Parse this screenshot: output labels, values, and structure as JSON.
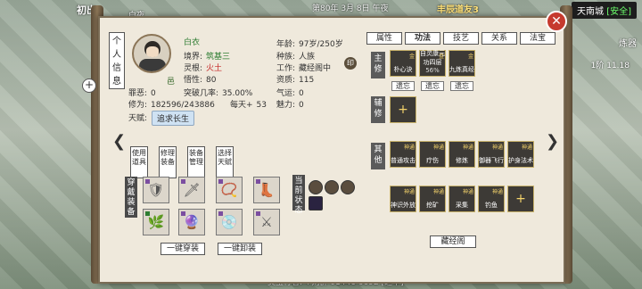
{
  "world": {
    "top_left_title": "初出",
    "time_of_day": "白夜",
    "top_center": "第80年 3月 8日 午夜",
    "top_event": "丰辰道友3",
    "city": "天南城",
    "city_status": "[安全]",
    "right_label1": "炼器",
    "right_label2": "1阶 11.18",
    "bottom_ticker": "灵宝行者: +刘群 01446 6692 [道本]",
    "bottom_count": "(1/10)"
  },
  "panel": {
    "vertical_title": "个人信息",
    "char_label_under_avatar": "邑",
    "name_label": "白衣",
    "tabs": [
      "属性",
      "功法",
      "技艺",
      "关系",
      "法宝"
    ],
    "active_tab": "功法",
    "info": {
      "realm_label": "境界:",
      "realm_value": "筑基三",
      "root_label": "灵根:",
      "root_value": "火土",
      "wisdom_label": "悟性:",
      "wisdom_value": "80",
      "sin_label": "罪恶:",
      "sin_value": "0",
      "break_label": "突破几率:",
      "break_value": "35.00%",
      "cult_label": "修为:",
      "cult_value": "182596/243886",
      "daily_label": "每天+",
      "daily_value": "53",
      "age_label": "年龄:",
      "age_value": "97岁/250岁",
      "race_label": "种族:",
      "race_value": "人族",
      "job_label": "工作:",
      "job_value": "藏经阁中",
      "qual_label": "资质:",
      "qual_value": "115",
      "qi_label": "气运:",
      "qi_value": "0",
      "charm_label": "魅力:",
      "charm_value": "0",
      "talent_label": "天赋:",
      "talent_value": "追求长生"
    },
    "seal_text": "印",
    "main_label": "主修",
    "aux_label": "辅修",
    "other_label": "其他",
    "main_skills": [
      {
        "name": "朴心诀",
        "tier": "金",
        "pct": ""
      },
      {
        "name": "自灵康元功四层",
        "tier": "金",
        "pct": "56%"
      },
      {
        "name": "九炼真经",
        "tier": "金",
        "pct": ""
      }
    ],
    "forget_btn": "遗忘",
    "other_skills_row1": [
      {
        "name": "普通攻击",
        "tier": "神通"
      },
      {
        "name": "疗伤",
        "tier": "神通"
      },
      {
        "name": "修炼",
        "tier": "神通"
      },
      {
        "name": "御器飞行",
        "tier": "神通"
      },
      {
        "name": "护身法术",
        "tier": "神通"
      }
    ],
    "other_skills_row2": [
      {
        "name": "神识外放",
        "tier": "神通"
      },
      {
        "name": "挖矿",
        "tier": "神通"
      },
      {
        "name": "采集",
        "tier": "神通"
      },
      {
        "name": "钓鱼",
        "tier": "神通"
      }
    ],
    "cangjing_btn": "藏经阁",
    "side_buttons": [
      "使用道具",
      "修理装备",
      "装备管理",
      "选择天赋"
    ],
    "equip_label": "穿戴装备",
    "current_status_label": "当前状态",
    "equip_all_btn": "一键穿装",
    "unequip_all_btn": "一键卸装"
  }
}
